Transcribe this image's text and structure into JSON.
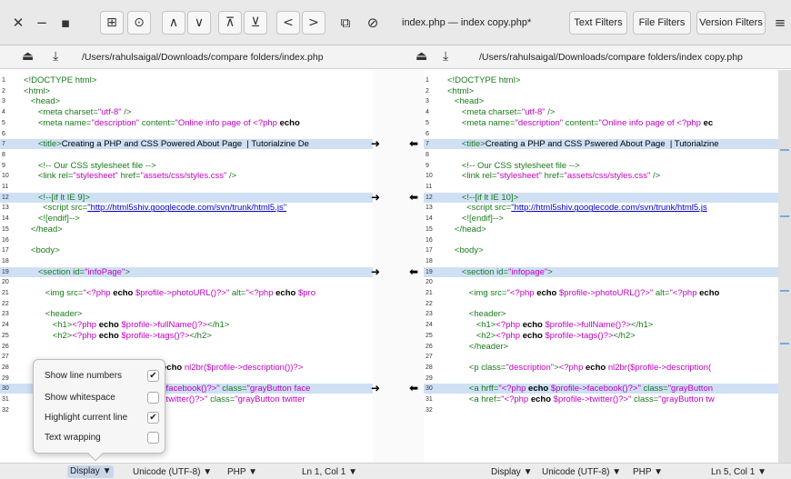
{
  "toolbar": {
    "close": "✕",
    "minimize": "−",
    "maximize": "▪",
    "btn_add": "⊞",
    "btn_clock": "⊙",
    "btn_up": "∧",
    "btn_down": "∨",
    "btn_first": "⊼",
    "btn_last": "⊻",
    "btn_prev": "<",
    "btn_next": ">",
    "btn_copy": "⧉",
    "btn_stop": "⊘",
    "title": "index.php — index copy.php*",
    "text_filters": "Text Filters",
    "file_filters": "File Filters",
    "version_filters": "Version Filters",
    "menu": "≡"
  },
  "left": {
    "path": "/Users/rahulsaigal/Downloads/compare folders/index.php",
    "lines": [
      {
        "n": "1",
        "html": "<span class='tg'>&lt;!DOCTYPE html&gt;</span>"
      },
      {
        "n": "2",
        "html": "<span class='tg'>&lt;html&gt;</span>"
      },
      {
        "n": "3",
        "html": "&nbsp;&nbsp;&nbsp;<span class='tg'>&lt;head&gt;</span>"
      },
      {
        "n": "4",
        "html": "&nbsp;&nbsp;&nbsp;&nbsp;&nbsp;&nbsp;<span class='tg'>&lt;meta charset=</span><span class='str'>\"utf-8\"</span><span class='tg'> /&gt;</span>"
      },
      {
        "n": "5",
        "html": "&nbsp;&nbsp;&nbsp;&nbsp;&nbsp;&nbsp;<span class='tg'>&lt;meta name=</span><span class='str'>\"description\"</span><span class='tg'> content=</span><span class='str'>\"Online info page of &lt;?php </span><span class='kw'>echo</span>"
      },
      {
        "n": "6",
        "html": ""
      },
      {
        "n": "7",
        "html": "&nbsp;&nbsp;&nbsp;&nbsp;&nbsp;&nbsp;<span class='tg'>&lt;title&gt;</span><span style='color:#000'>Creating a PHP and CSS Powered About Page &nbsp;| Tutorialzine De</span>",
        "hl": true
      },
      {
        "n": "8",
        "html": ""
      },
      {
        "n": "9",
        "html": "&nbsp;&nbsp;&nbsp;&nbsp;&nbsp;&nbsp;<span class='cm'>&lt;!-- Our CSS stylesheet file --&gt;</span>"
      },
      {
        "n": "10",
        "html": "&nbsp;&nbsp;&nbsp;&nbsp;&nbsp;&nbsp;<span class='tg'>&lt;link rel=</span><span class='str'>\"stylesheet\"</span><span class='tg'> href=</span><span class='str'>\"assets/css/styles.css\"</span><span class='tg'> /&gt;</span>"
      },
      {
        "n": "11",
        "html": ""
      },
      {
        "n": "12",
        "html": "&nbsp;&nbsp;&nbsp;&nbsp;&nbsp;&nbsp;<span class='cm'>&lt;!--[if lt IE 9]&gt;</span>",
        "hl": true
      },
      {
        "n": "13",
        "html": "&nbsp;&nbsp;&nbsp;&nbsp;&nbsp;&nbsp;&nbsp;&nbsp;<span class='tg'>&lt;script src=</span><span class='lnk'>\"http://html5shiv.googlecode.com/svn/trunk/html5.js\"</span>"
      },
      {
        "n": "14",
        "html": "&nbsp;&nbsp;&nbsp;&nbsp;&nbsp;&nbsp;<span class='cm'>&lt;![endif]--&gt;</span>"
      },
      {
        "n": "15",
        "html": "&nbsp;&nbsp;&nbsp;<span class='tg'>&lt;/head&gt;</span>"
      },
      {
        "n": "16",
        "html": ""
      },
      {
        "n": "17",
        "html": "&nbsp;&nbsp;&nbsp;<span class='tg'>&lt;body&gt;</span>"
      },
      {
        "n": "18",
        "html": ""
      },
      {
        "n": "19",
        "html": "&nbsp;&nbsp;&nbsp;&nbsp;&nbsp;&nbsp;<span class='tg'>&lt;section id=</span><span class='str'>\"infoPage\"</span><span class='tg'>&gt;</span>",
        "hl": true
      },
      {
        "n": "20",
        "html": ""
      },
      {
        "n": "21",
        "html": "&nbsp;&nbsp;&nbsp;&nbsp;&nbsp;&nbsp;&nbsp;&nbsp;&nbsp;<span class='tg'>&lt;img src=</span><span class='str'>\"&lt;?php </span><span class='kw'>echo</span><span class='str'> $profile-&gt;photoURL()?&gt;\"</span><span class='tg'> alt=</span><span class='str'>\"&lt;?php </span><span class='kw'>echo</span><span class='str'> $pro</span>"
      },
      {
        "n": "22",
        "html": ""
      },
      {
        "n": "23",
        "html": "&nbsp;&nbsp;&nbsp;&nbsp;&nbsp;&nbsp;&nbsp;&nbsp;&nbsp;<span class='tg'>&lt;header&gt;</span>"
      },
      {
        "n": "24",
        "html": "&nbsp;&nbsp;&nbsp;&nbsp;&nbsp;&nbsp;&nbsp;&nbsp;&nbsp;&nbsp;&nbsp;&nbsp;<span class='tg'>&lt;h1&gt;</span><span class='str'>&lt;?php </span><span class='kw'>echo</span><span class='str'> $profile-&gt;fullName()?&gt;</span><span class='tg'>&lt;/h1&gt;</span>"
      },
      {
        "n": "25",
        "html": "&nbsp;&nbsp;&nbsp;&nbsp;&nbsp;&nbsp;&nbsp;&nbsp;&nbsp;&nbsp;&nbsp;&nbsp;<span class='tg'>&lt;h2&gt;</span><span class='str'>&lt;?php </span><span class='kw'>echo</span><span class='str'> $profile-&gt;tags()?&gt;</span><span class='tg'>&lt;/h2&gt;</span>"
      },
      {
        "n": "26",
        "html": ""
      },
      {
        "n": "27",
        "html": ""
      },
      {
        "n": "28",
        "html": "&nbsp;&nbsp;&nbsp;&nbsp;&nbsp;&nbsp;&nbsp;&nbsp;&nbsp;<span class='tg'>&lt;p class=</span><span class='str'>\"description\"</span><span class='tg'>&gt;</span><span class='str'>&lt;?php </span><span class='kw'>echo</span><span class='str'> nl2br($profile-&gt;description())?&gt;</span>"
      },
      {
        "n": "29",
        "html": ""
      },
      {
        "n": "30",
        "html": "&nbsp;&nbsp;&nbsp;&nbsp;&nbsp;&nbsp;&nbsp;&nbsp;&nbsp;<span class='tg'>&lt;a href=</span><span class='str'>\"&lt;?php </span><span class='kw'>echo</span><span class='str'> $profile-&gt;facebook()?&gt;\"</span><span class='tg'> class=</span><span class='str'>\"grayButton face</span>",
        "hl": true
      },
      {
        "n": "31",
        "html": "&nbsp;&nbsp;&nbsp;&nbsp;&nbsp;&nbsp;&nbsp;&nbsp;&nbsp;<span class='tg'>&lt;a href=</span><span class='str'>\"&lt;?php </span><span class='kw'>echo</span><span class='str'> $profile-&gt;twitter()?&gt;\"</span><span class='tg'> class=</span><span class='str'>\"grayButton twitter</span>"
      },
      {
        "n": "32",
        "html": ""
      }
    ]
  },
  "right": {
    "path": "/Users/rahulsaigal/Downloads/compare folders/index copy.php",
    "lines": [
      {
        "n": "1",
        "html": "<span class='tg'>&lt;!DOCTYPE html&gt;</span>"
      },
      {
        "n": "2",
        "html": "<span class='tg'>&lt;html&gt;</span>"
      },
      {
        "n": "3",
        "html": "&nbsp;&nbsp;&nbsp;<span class='tg'>&lt;head&gt;</span>"
      },
      {
        "n": "4",
        "html": "&nbsp;&nbsp;&nbsp;&nbsp;&nbsp;&nbsp;<span class='tg'>&lt;meta charset=</span><span class='str'>\"utf-8\"</span><span class='tg'> /&gt;</span>"
      },
      {
        "n": "5",
        "html": "&nbsp;&nbsp;&nbsp;&nbsp;&nbsp;&nbsp;<span class='tg'>&lt;meta name=</span><span class='str'>\"description\"</span><span class='tg'> content=</span><span class='str'>\"Online info page of &lt;?php </span><span class='kw'>ec</span>"
      },
      {
        "n": "6",
        "html": ""
      },
      {
        "n": "7",
        "html": "&nbsp;&nbsp;&nbsp;&nbsp;&nbsp;&nbsp;<span class='tg'>&lt;title&gt;</span><span style='color:#000'>Creating a PHP and CSS Pswered About Page &nbsp;| Tutorialzine</span>",
        "hl": true
      },
      {
        "n": "8",
        "html": ""
      },
      {
        "n": "9",
        "html": "&nbsp;&nbsp;&nbsp;&nbsp;&nbsp;&nbsp;<span class='cm'>&lt;!-- Our CSS stylesheet file --&gt;</span>"
      },
      {
        "n": "10",
        "html": "&nbsp;&nbsp;&nbsp;&nbsp;&nbsp;&nbsp;<span class='tg'>&lt;link rel=</span><span class='str'>\"stylesheet\"</span><span class='tg'> href=</span><span class='str'>\"assets/css/styles.css\"</span><span class='tg'> /&gt;</span>"
      },
      {
        "n": "11",
        "html": ""
      },
      {
        "n": "12",
        "html": "&nbsp;&nbsp;&nbsp;&nbsp;&nbsp;&nbsp;<span class='cm'>&lt;!--[if lt IE 10]&gt;</span>",
        "hl": true
      },
      {
        "n": "13",
        "html": "&nbsp;&nbsp;&nbsp;&nbsp;&nbsp;&nbsp;&nbsp;&nbsp;<span class='tg'>&lt;script src=</span><span class='lnk'>\"http://html5shiv.googlecode.com/svn/trunk/html5.js</span>"
      },
      {
        "n": "14",
        "html": "&nbsp;&nbsp;&nbsp;&nbsp;&nbsp;&nbsp;<span class='cm'>&lt;![endif]--&gt;</span>"
      },
      {
        "n": "15",
        "html": "&nbsp;&nbsp;&nbsp;<span class='tg'>&lt;/head&gt;</span>"
      },
      {
        "n": "16",
        "html": ""
      },
      {
        "n": "17",
        "html": "&nbsp;&nbsp;&nbsp;<span class='tg'>&lt;body&gt;</span>"
      },
      {
        "n": "18",
        "html": ""
      },
      {
        "n": "19",
        "html": "&nbsp;&nbsp;&nbsp;&nbsp;&nbsp;&nbsp;<span class='tg'>&lt;section id=</span><span class='str'>\"infopage\"</span><span class='tg'>&gt;</span>",
        "hl": true
      },
      {
        "n": "20",
        "html": ""
      },
      {
        "n": "21",
        "html": "&nbsp;&nbsp;&nbsp;&nbsp;&nbsp;&nbsp;&nbsp;&nbsp;&nbsp;<span class='tg'>&lt;img src=</span><span class='str'>\"&lt;?php </span><span class='kw'>echo</span><span class='str'> $profile-&gt;photoURL()?&gt;\"</span><span class='tg'> alt=</span><span class='str'>\"&lt;?php </span><span class='kw'>echo</span>"
      },
      {
        "n": "22",
        "html": ""
      },
      {
        "n": "23",
        "html": "&nbsp;&nbsp;&nbsp;&nbsp;&nbsp;&nbsp;&nbsp;&nbsp;&nbsp;<span class='tg'>&lt;header&gt;</span>"
      },
      {
        "n": "24",
        "html": "&nbsp;&nbsp;&nbsp;&nbsp;&nbsp;&nbsp;&nbsp;&nbsp;&nbsp;&nbsp;&nbsp;&nbsp;<span class='tg'>&lt;h1&gt;</span><span class='str'>&lt;?php </span><span class='kw'>echo</span><span class='str'> $profile-&gt;fullName()?&gt;</span><span class='tg'>&lt;/h1&gt;</span>"
      },
      {
        "n": "25",
        "html": "&nbsp;&nbsp;&nbsp;&nbsp;&nbsp;&nbsp;&nbsp;&nbsp;&nbsp;&nbsp;&nbsp;&nbsp;<span class='tg'>&lt;h2&gt;</span><span class='str'>&lt;?php </span><span class='kw'>echo</span><span class='str'> $profile-&gt;tags()?&gt;</span><span class='tg'>&lt;/h2&gt;</span>"
      },
      {
        "n": "26",
        "html": "&nbsp;&nbsp;&nbsp;&nbsp;&nbsp;&nbsp;&nbsp;&nbsp;&nbsp;<span class='tg'>&lt;/header&gt;</span>"
      },
      {
        "n": "27",
        "html": ""
      },
      {
        "n": "28",
        "html": "&nbsp;&nbsp;&nbsp;&nbsp;&nbsp;&nbsp;&nbsp;&nbsp;&nbsp;<span class='tg'>&lt;p class=</span><span class='str'>\"description\"</span><span class='tg'>&gt;</span><span class='str'>&lt;?php </span><span class='kw'>echo</span><span class='str'> nl2br($profile-&gt;description(</span>"
      },
      {
        "n": "29",
        "html": ""
      },
      {
        "n": "30",
        "html": "&nbsp;&nbsp;&nbsp;&nbsp;&nbsp;&nbsp;&nbsp;&nbsp;&nbsp;<span class='tg'>&lt;a hrff=</span><span class='str'>\"&lt;?php </span><span class='kw'>echo</span><span class='str'> $profile-&gt;facebook()?&gt;\"</span><span class='tg'> class=</span><span class='str'>\"grayButton</span>",
        "hl": true
      },
      {
        "n": "31",
        "html": "&nbsp;&nbsp;&nbsp;&nbsp;&nbsp;&nbsp;&nbsp;&nbsp;&nbsp;<span class='tg'>&lt;a href=</span><span class='str'>\"&lt;?php </span><span class='kw'>echo</span><span class='str'> $profile-&gt;twitter()?&gt;\"</span><span class='tg'> class=</span><span class='str'>\"grayButton tw</span>"
      },
      {
        "n": "32",
        "html": ""
      }
    ]
  },
  "arrows": {
    "right": "➜",
    "left": "⬅"
  },
  "popup": {
    "show_line_numbers": "Show line numbers",
    "show_whitespace": "Show whitespace",
    "highlight_current_line": "Highlight current line",
    "text_wrapping": "Text wrapping",
    "check": "✔"
  },
  "status": {
    "left_display": "Display ▼",
    "left_encoding": "Unicode (UTF-8) ▼",
    "left_lang": "PHP ▼",
    "left_pos": "Ln 1, Col 1 ▼",
    "right_display": "Display ▼",
    "right_encoding": "Unicode (UTF-8) ▼",
    "right_lang": "PHP ▼",
    "right_pos": "Ln 5, Col 1 ▼"
  },
  "icons": {
    "save": "⏏",
    "download": "⤓"
  }
}
